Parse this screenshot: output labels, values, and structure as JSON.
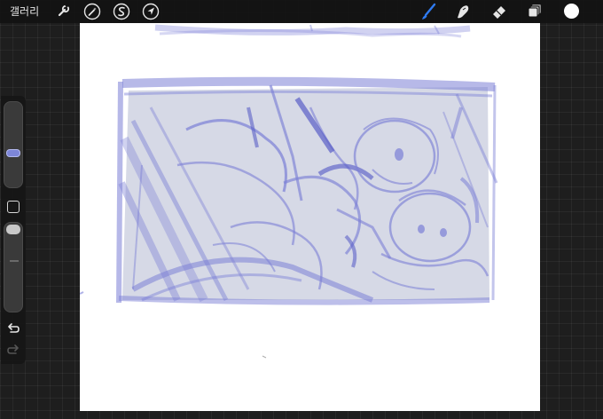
{
  "topbar": {
    "gallery_label": "갤러리",
    "actions_icon": "wrench-icon",
    "adjustments_icon": "magic-wand-icon",
    "selection_icon": "selection-s-icon",
    "transform_icon": "arrow-cursor-icon",
    "brush_icon": "brush-icon",
    "smudge_icon": "smudge-finger-icon",
    "eraser_icon": "eraser-icon",
    "layers_icon": "layers-icon",
    "active_tool": "brush",
    "current_color": "#ffffff",
    "active_tool_color": "#2f7bf2"
  },
  "sidebar": {
    "brush_size": 0.38,
    "brush_opacity": 1.0,
    "undo_icon": "undo-icon",
    "redo_icon": "redo-icon",
    "redo_enabled": false
  },
  "canvas": {
    "background": "#ffffff",
    "sketch_color": "#7b7fd6",
    "fill_color": "#d8dbe6"
  }
}
